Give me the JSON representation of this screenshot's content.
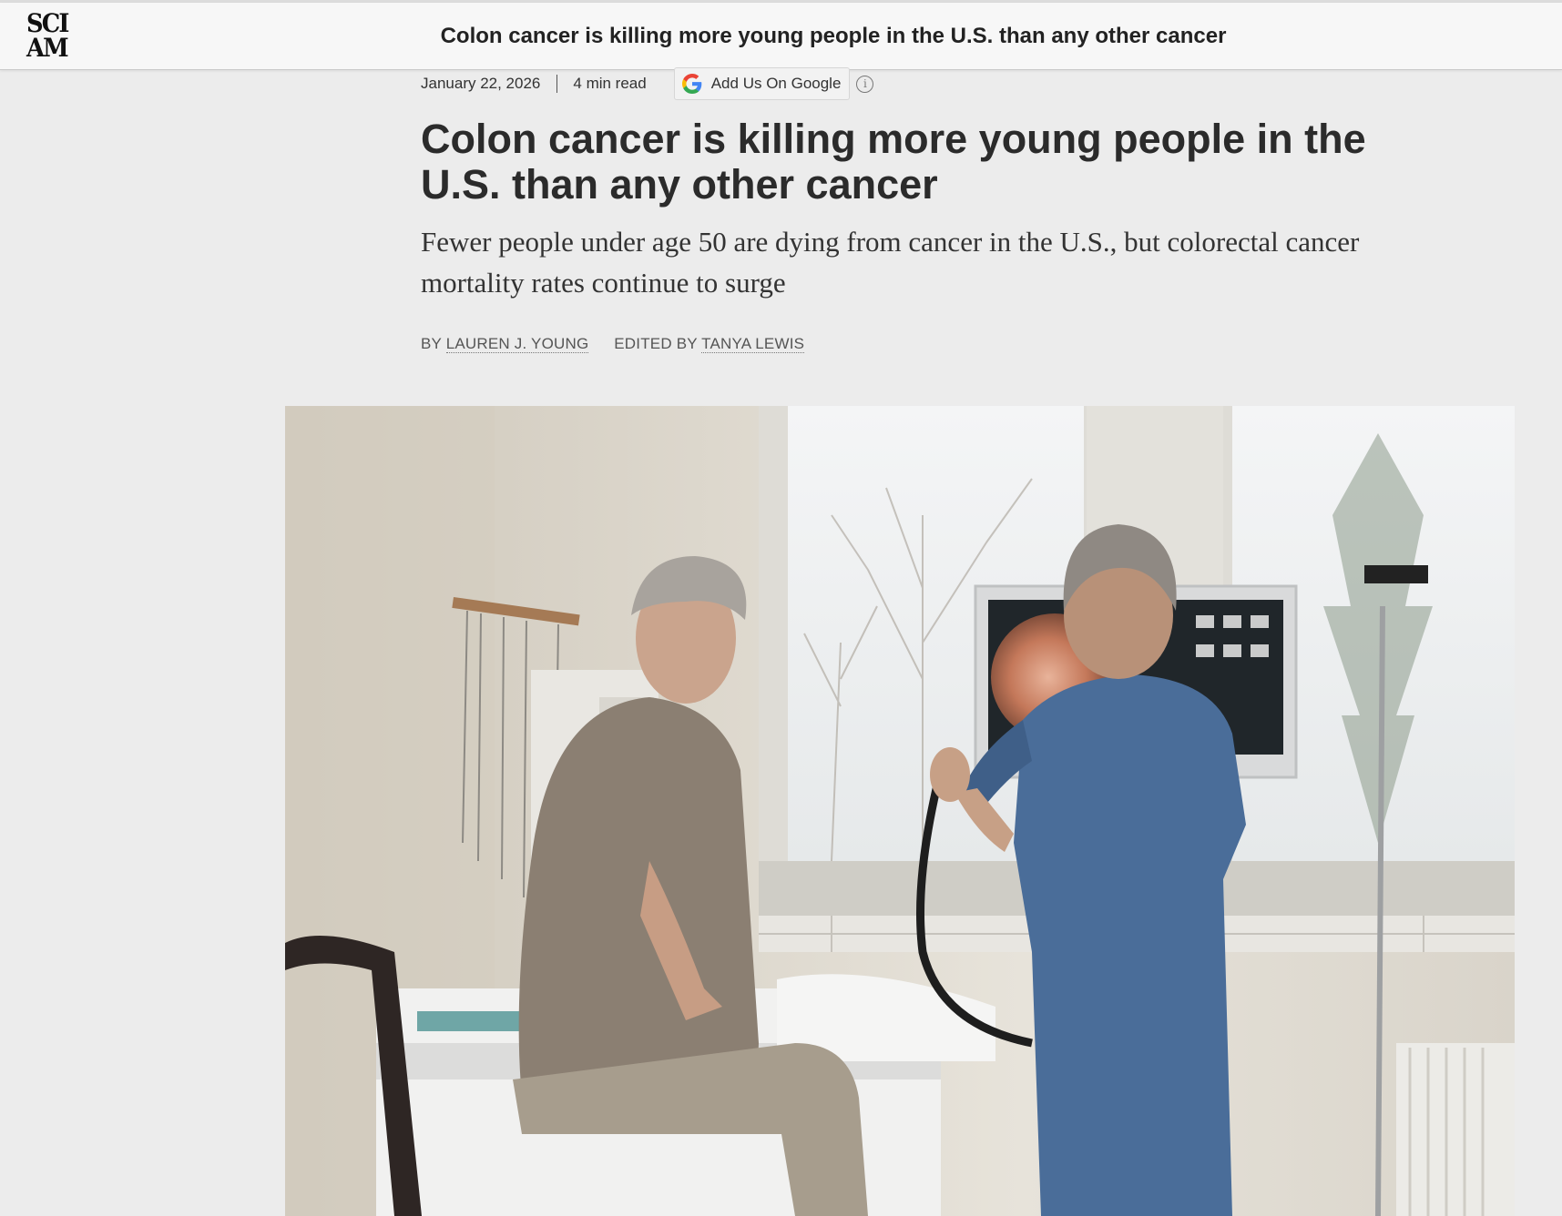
{
  "header": {
    "logo_line1": "SCI",
    "logo_line2": "AM",
    "title": "Colon cancer is killing more young people in the U.S. than any other cancer"
  },
  "meta": {
    "date": "January 22, 2026",
    "read_time": "4 min read",
    "google_button_label": "Add Us On Google",
    "info_glyph": "i"
  },
  "article": {
    "headline": "Colon cancer is killing more young people in the U.S. than any other cancer",
    "dek": "Fewer people under age 50 are dying from cancer in the U.S., but colorectal cancer mortality rates continue to surge",
    "byline": {
      "by_prefix": "BY",
      "author": "LAUREN J. YOUNG",
      "edited_prefix": "EDITED BY",
      "editor": "TANYA LEWIS"
    }
  },
  "icons": {
    "google": "google-g-icon",
    "info": "info-circle-icon"
  },
  "colors": {
    "page_background": "#ececec",
    "header_background": "#f7f7f7",
    "headline": "#2b2b2b",
    "scrubs_blue": "#4a6d99"
  }
}
